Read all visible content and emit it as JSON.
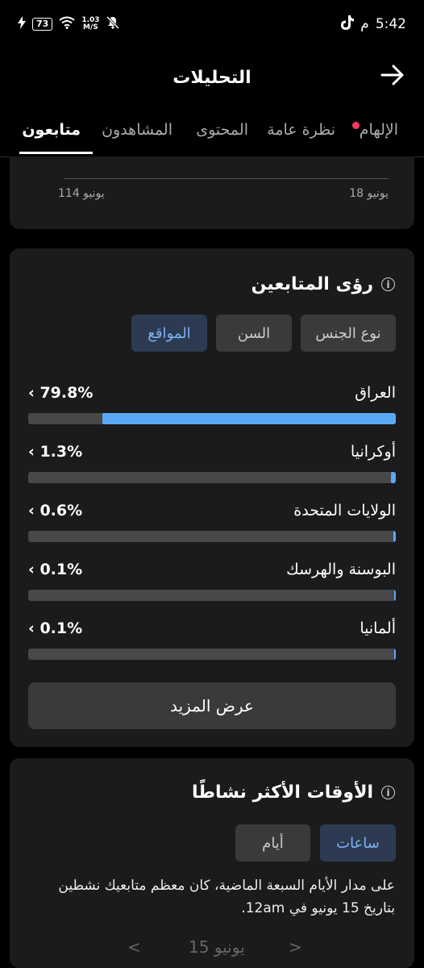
{
  "status": {
    "time": "5:42",
    "ampm": "م",
    "battery": "73",
    "net_speed_value": "1.03",
    "net_speed_unit": "M/S"
  },
  "header": {
    "title": "التحليلات"
  },
  "tabs": [
    {
      "label": "الإلهام",
      "has_dot": true
    },
    {
      "label": "نظرة عامة"
    },
    {
      "label": "المحتوى"
    },
    {
      "label": "المشاهدون"
    },
    {
      "label": "متابعون",
      "active": true
    }
  ],
  "chart_card": {
    "x_label_right": "يونيو 18",
    "x_label_left": "يونيو 114"
  },
  "followers_insights": {
    "title": "رؤى المتابعين",
    "filters": [
      {
        "label": "نوع الجنس"
      },
      {
        "label": "السن"
      },
      {
        "label": "المواقع",
        "selected": true
      }
    ],
    "locations": [
      {
        "name": "العراق",
        "pct_text": "79.8%",
        "fraction": 0.798
      },
      {
        "name": "أوكرانيا",
        "pct_text": "1.3%",
        "fraction": 0.013
      },
      {
        "name": "الولايات المتحدة",
        "pct_text": "0.6%",
        "fraction": 0.006
      },
      {
        "name": "البوسنة والهرسك",
        "pct_text": "0.1%",
        "fraction": 0.001
      },
      {
        "name": "ألمانيا",
        "pct_text": "0.1%",
        "fraction": 0.001
      }
    ],
    "show_more": "عرض المزيد"
  },
  "active_times": {
    "title": "الأوقات الأكثر نشاطًا",
    "filters": [
      {
        "label": "ساعات",
        "selected": true
      },
      {
        "label": "أيام"
      }
    ],
    "description": "على مدار الأيام السبعة الماضية، كان معظم متابعيك نشطين بتاريخ 15 يونيو في 12am.",
    "date_label": "15 يونيو"
  },
  "colors": {
    "accent": "#5aa8f5",
    "card_bg": "#1b1b1d",
    "notification_dot": "#ff3b5c"
  }
}
